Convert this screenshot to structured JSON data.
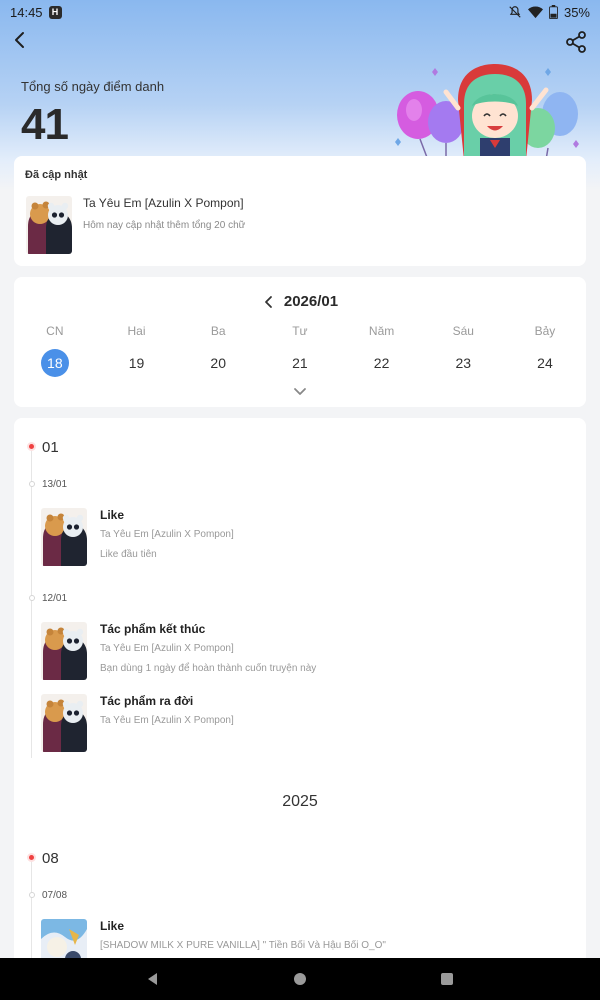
{
  "status_bar": {
    "time": "14:45",
    "app_badge": "H",
    "battery": "35%",
    "icons": [
      "mute-icon",
      "wifi-icon",
      "battery-icon"
    ]
  },
  "header": {
    "checkin_label": "Tổng số ngày điểm danh",
    "checkin_count": "41"
  },
  "updated": {
    "title": "Đã cập nhật",
    "book": "Ta Yêu Em [Azulin X Pompon]",
    "desc": "Hôm nay cập nhật thêm tổng 20 chữ"
  },
  "calendar": {
    "month": "2026/01",
    "days": [
      {
        "weekday": "CN",
        "day": "18",
        "active": true
      },
      {
        "weekday": "Hai",
        "day": "19",
        "active": false
      },
      {
        "weekday": "Ba",
        "day": "20",
        "active": false
      },
      {
        "weekday": "Tư",
        "day": "21",
        "active": false
      },
      {
        "weekday": "Năm",
        "day": "22",
        "active": false
      },
      {
        "weekday": "Sáu",
        "day": "23",
        "active": false
      },
      {
        "weekday": "Bảy",
        "day": "24",
        "active": false
      }
    ]
  },
  "timeline": {
    "month1": "01",
    "date1": "13/01",
    "entry1": {
      "title": "Like",
      "book": "Ta Yêu Em [Azulin X Pompon]",
      "desc": "Like đầu tiên"
    },
    "date2": "12/01",
    "entry2": {
      "title": "Tác phẩm kết thúc",
      "book": "Ta Yêu Em [Azulin X Pompon]",
      "desc": "Bạn dùng 1 ngày để hoàn thành cuốn truyện này"
    },
    "entry3": {
      "title": "Tác phẩm ra đời",
      "book": "Ta Yêu Em [Azulin X Pompon]"
    },
    "year": "2025",
    "month2": "08",
    "date3": "07/08",
    "entry4": {
      "title": "Like",
      "book": "[SHADOW MILK X PURE VANILLA] \" Tiền Bối Và Hậu Bối O_O\""
    }
  },
  "colors": {
    "accent": "#4a90e8",
    "header_gradient_top": "#8ab8ef",
    "red_marker": "#ef4040"
  }
}
